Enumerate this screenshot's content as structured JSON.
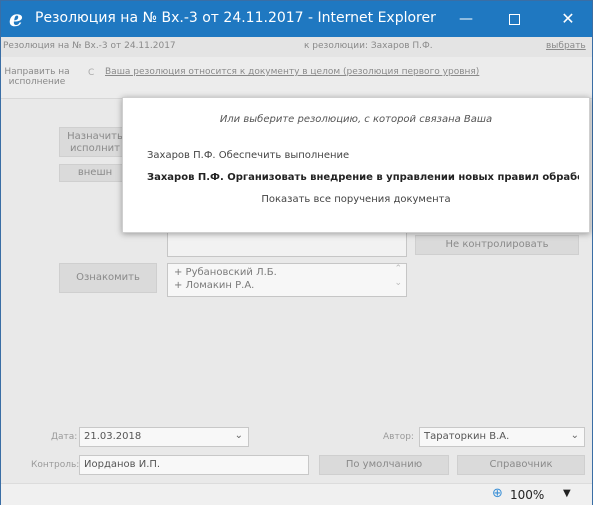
{
  "window": {
    "title": "Резолюция на № Вх.-3 от 24.11.2017 - Internet Explorer",
    "controls": {
      "minimize": "—",
      "close": "✕"
    }
  },
  "info_row": {
    "document": "Резолюция на № Вх.-3 от 24.11.2017",
    "to_resolution": "к резолюции: Захаров П.Ф.",
    "choose_link": "выбрать"
  },
  "send_row": {
    "send_button": "Направить на исполнение",
    "partial_c": "С",
    "doc_link": "Ваша резолюция относится к документу в целом (резолюция первого уровня)"
  },
  "background": {
    "assign_button": "Назначить исполнит",
    "external_button": "внешн",
    "no_control_button": "Не контролировать",
    "familiarize_button": "Ознакомить",
    "familiarize_list": [
      "+ Рубановский Л.Б.",
      "+ Ломакин Р.А."
    ]
  },
  "bottom": {
    "date_label": "Дата:",
    "date_value": "21.03.2018",
    "author_label": "Автор:",
    "author_value": "Тараторкин В.А.",
    "control_label": "Контроль:",
    "control_value": "Иорданов И.П.",
    "default_button": "По умолчанию",
    "reference_button": "Справочник"
  },
  "popup": {
    "hint": "Или выберите резолюцию, с которой связана Ваша",
    "option_1": "Захаров П.Ф. Обеспечить выполнение",
    "option_2": "Захаров П.Ф. Организовать внедрение в управлении новых правил обрабо...",
    "show_all": "Показать все поручения документа"
  },
  "statusbar": {
    "zoom": "100%"
  },
  "colors": {
    "titlebar": "#1f78c1",
    "window_bg": "#e9e9e9",
    "popup_bg": "#ffffff"
  },
  "icons": {
    "app": "ie-logo-icon",
    "zoom": "zoom-icon"
  }
}
